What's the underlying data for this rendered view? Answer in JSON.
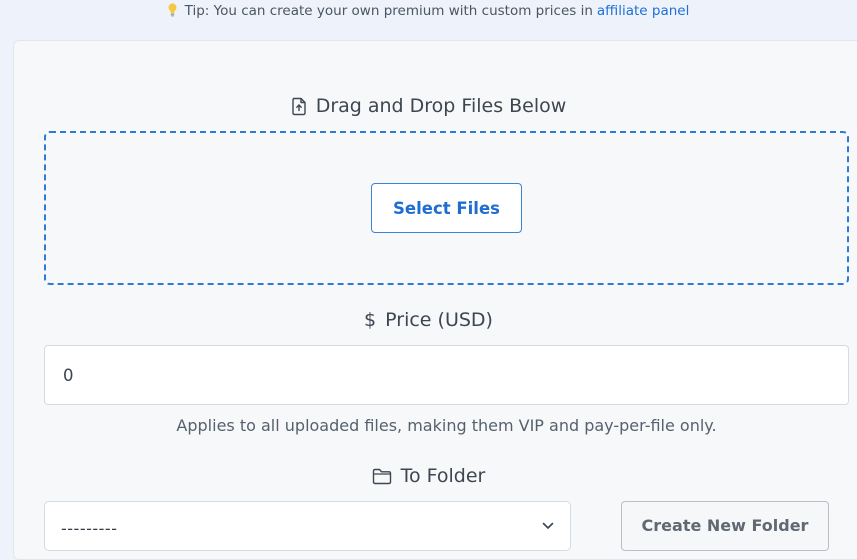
{
  "tip": {
    "text": "Tip: You can create your own premium with custom prices in",
    "link": "affiliate panel",
    "icon": "lightbulb-icon"
  },
  "upload": {
    "heading": "Drag and Drop Files Below",
    "heading_icon": "file-upload-icon",
    "select_label": "Select Files"
  },
  "price": {
    "heading": "Price (USD)",
    "heading_icon": "dollar-icon",
    "value": "0",
    "help": "Applies to all uploaded files, making them VIP and pay-per-file only."
  },
  "folder": {
    "heading": "To Folder",
    "heading_icon": "folder-icon",
    "selected": "---------",
    "create_label": "Create New Folder"
  },
  "colors": {
    "accent": "#1e6fd6",
    "dropzone_border": "#2d7bd8",
    "background": "#eef3fb",
    "card": "#f6f8fa"
  }
}
